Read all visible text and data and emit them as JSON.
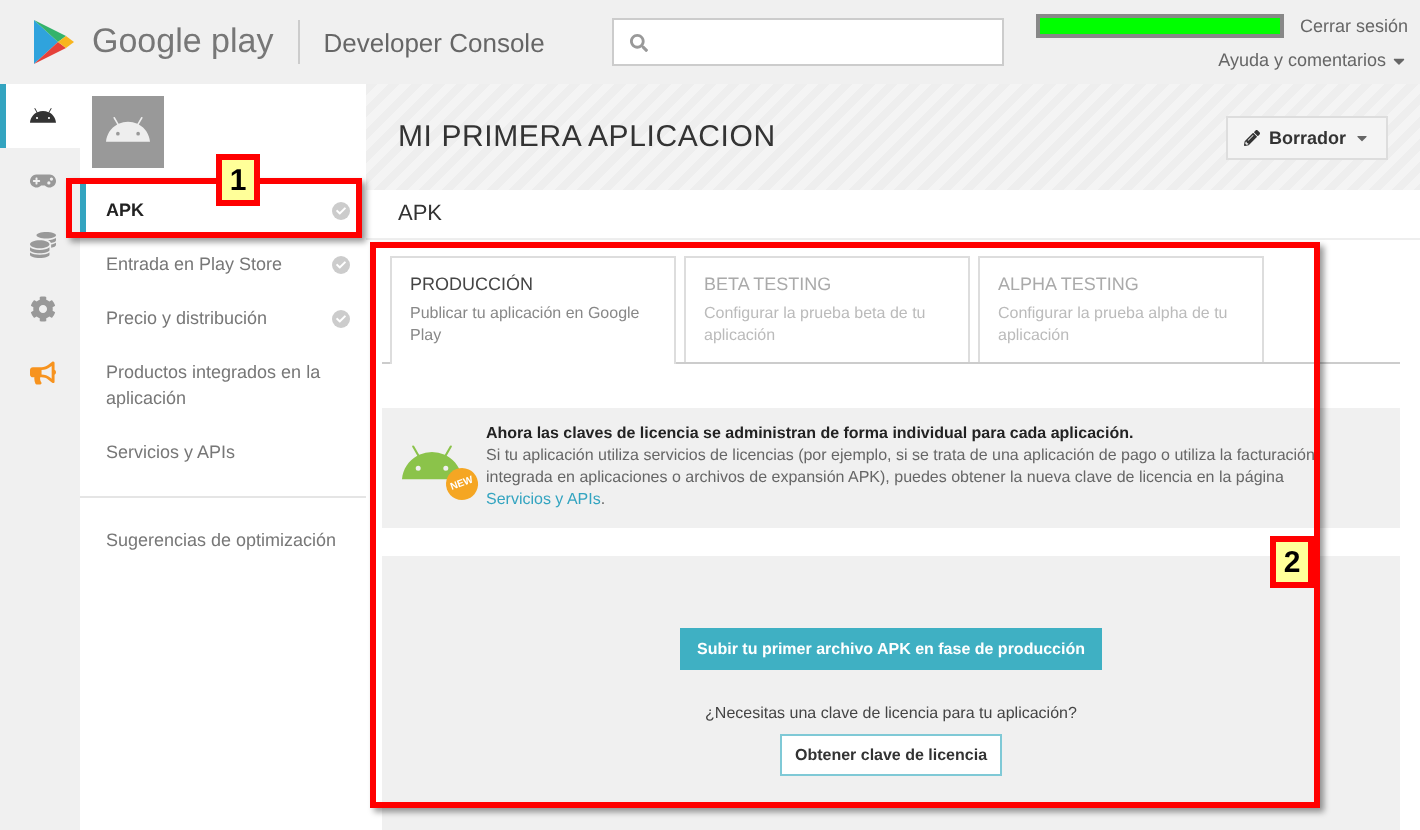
{
  "header": {
    "brand": "Google play",
    "product": "Developer Console",
    "links": [
      "Cerrar sesión",
      "Ayuda y comentarios"
    ]
  },
  "rail": [
    {
      "kind": "android",
      "selected": true
    },
    {
      "kind": "games",
      "selected": false
    },
    {
      "kind": "finance",
      "selected": false
    },
    {
      "kind": "settings",
      "selected": false
    },
    {
      "kind": "alerts",
      "selected": false
    }
  ],
  "sidebar": {
    "items": [
      {
        "label": "APK",
        "done": true,
        "selected": true
      },
      {
        "label": "Entrada en Play Store",
        "done": true,
        "selected": false
      },
      {
        "label": "Precio y distribución",
        "done": true,
        "selected": false
      },
      {
        "label": "Productos integrados en la aplicación",
        "done": false,
        "selected": false
      },
      {
        "label": "Servicios y APIs",
        "done": false,
        "selected": false
      }
    ],
    "extra": [
      {
        "label": "Sugerencias de optimización",
        "selected": false
      }
    ]
  },
  "main": {
    "title": "MI PRIMERA APLICACION",
    "status": "Borrador",
    "section": "APK",
    "tabs": [
      {
        "title": "PRODUCCIÓN",
        "subtitle": "Publicar tu aplicación en Google Play",
        "selected": true
      },
      {
        "title": "BETA TESTING",
        "subtitle": "Configurar la prueba beta de tu aplicación",
        "selected": false
      },
      {
        "title": "ALPHA TESTING",
        "subtitle": "Configurar la prueba alpha de tu aplicación",
        "selected": false
      }
    ],
    "notice": {
      "badge": "NEW",
      "heading": "Ahora las claves de licencia se administran de forma individual para cada aplicación.",
      "body": "Si tu aplicación utiliza servicios de licencias (por ejemplo, si se trata de una aplicación de pago o utiliza la facturación integrada en aplicaciones o archivos de expansión APK), puedes obtener la nueva clave de licencia en la página ",
      "link": "Servicios y APIs",
      "after": "."
    },
    "upload_button": "Subir tu primer archivo APK en fase de producción",
    "question": "¿Necesitas una clave de licencia para tu aplicación?",
    "key_button": "Obtener clave de licencia"
  },
  "annotations": [
    {
      "label": "1"
    },
    {
      "label": "2"
    }
  ]
}
